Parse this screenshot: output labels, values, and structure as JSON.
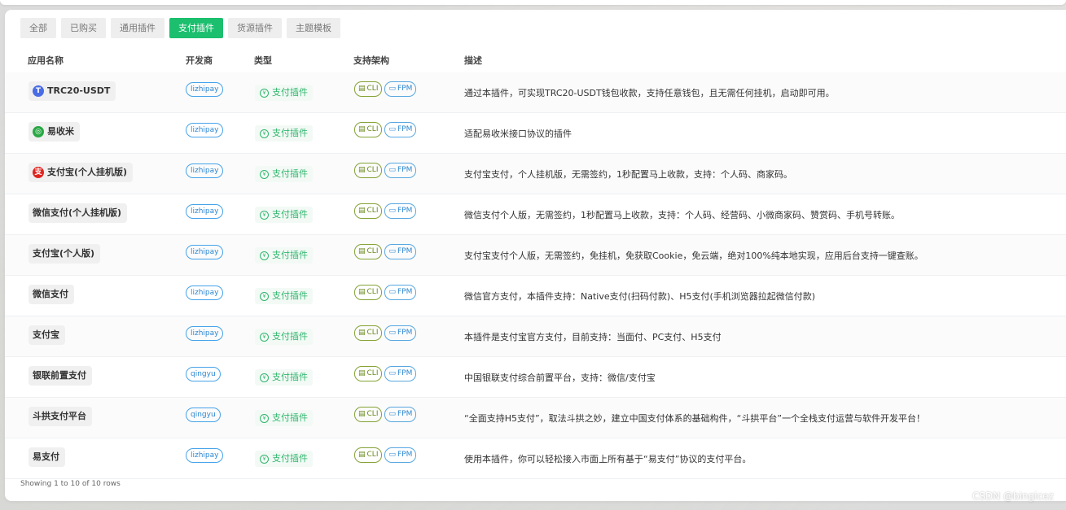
{
  "tabs": [
    {
      "label": "全部",
      "active": false
    },
    {
      "label": "已购买",
      "active": false
    },
    {
      "label": "通用插件",
      "active": false
    },
    {
      "label": "支付插件",
      "active": true
    },
    {
      "label": "货源插件",
      "active": false
    },
    {
      "label": "主题模板",
      "active": false
    }
  ],
  "columns": {
    "name": "应用名称",
    "developer": "开发商",
    "type": "类型",
    "arch": "支持架构",
    "desc": "描述"
  },
  "arch_labels": {
    "cli": "CLI",
    "fpm": "FPM"
  },
  "rows": [
    {
      "icon": "tether-icon",
      "icon_color": "#4a6de5",
      "icon_glyph": "T",
      "name": "TRC20-USDT",
      "developer": "lizhipay",
      "type": "支付插件",
      "desc": "通过本插件，可实现TRC20-USDT钱包收款，支持任意钱包，且无需任何挂机，启动即可用。"
    },
    {
      "icon": "yishoumi-icon",
      "icon_color": "#2aa845",
      "icon_glyph": "◎",
      "name": "易收米",
      "developer": "lizhipay",
      "type": "支付插件",
      "desc": "适配易收米接口协议的插件"
    },
    {
      "icon": "alipay-personal-icon",
      "icon_color": "#e0241f",
      "icon_glyph": "支",
      "name": "支付宝(个人挂机版)",
      "developer": "lizhipay",
      "type": "支付插件",
      "desc": "支付宝支付，个人挂机版，无需签约，1秒配置马上收款，支持：个人码、商家码。"
    },
    {
      "icon": "",
      "icon_color": "",
      "icon_glyph": "",
      "name": "微信支付(个人挂机版)",
      "developer": "lizhipay",
      "type": "支付插件",
      "desc": "微信支付个人版，无需签约，1秒配置马上收款，支持：个人码、经营码、小微商家码、赞赏码、手机号转账。"
    },
    {
      "icon": "",
      "icon_color": "",
      "icon_glyph": "",
      "name": "支付宝(个人版)",
      "developer": "lizhipay",
      "type": "支付插件",
      "desc": "支付宝支付个人版，无需签约，免挂机，免获取Cookie，免云端，绝对100%纯本地实现，应用后台支持一键查账。"
    },
    {
      "icon": "",
      "icon_color": "",
      "icon_glyph": "",
      "name": "微信支付",
      "developer": "lizhipay",
      "type": "支付插件",
      "desc": "微信官方支付，本插件支持：Native支付(扫码付款)、H5支付(手机浏览器拉起微信付款)"
    },
    {
      "icon": "",
      "icon_color": "",
      "icon_glyph": "",
      "name": "支付宝",
      "developer": "lizhipay",
      "type": "支付插件",
      "desc": "本插件是支付宝官方支付，目前支持：当面付、PC支付、H5支付"
    },
    {
      "icon": "",
      "icon_color": "",
      "icon_glyph": "",
      "name": "银联前置支付",
      "developer": "qingyu",
      "type": "支付插件",
      "desc": "中国银联支付综合前置平台，支持：微信/支付宝"
    },
    {
      "icon": "",
      "icon_color": "",
      "icon_glyph": "",
      "name": "斗拱支付平台",
      "developer": "qingyu",
      "type": "支付插件",
      "desc": "“全面支持H5支付”，取法斗拱之妙，建立中国支付体系的基础构件，“斗拱平台”一个全栈支付运营与软件开发平台！"
    },
    {
      "icon": "",
      "icon_color": "",
      "icon_glyph": "",
      "name": "易支付",
      "developer": "lizhipay",
      "type": "支付插件",
      "desc": "使用本插件，你可以轻松接入市面上所有基于“易支付”协议的支付平台。"
    }
  ],
  "footer": "Showing 1 to 10 of 10 rows",
  "watermark": "CSDN @bingicez"
}
